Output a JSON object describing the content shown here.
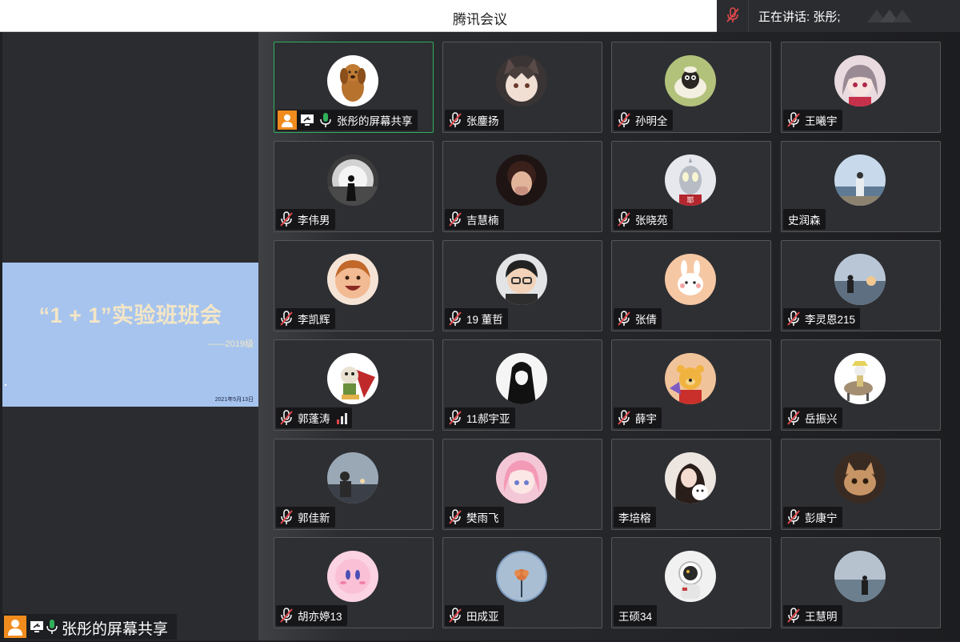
{
  "app": {
    "title": "腾讯会议"
  },
  "speaking": {
    "text": "正在讲话: 张彤;"
  },
  "slide": {
    "title": "“1 + 1”实验班班会",
    "subtitle": "——2019级",
    "date": "2021年5月13日"
  },
  "share": {
    "label": "张彤的屏幕共享"
  },
  "colors": {
    "accent_green": "#2fb05b",
    "host_orange": "#f08c1e",
    "muted_red": "#e0484b",
    "slide_bg": "#a6c4ee"
  },
  "participants": [
    {
      "name": "张彤的屏幕共享",
      "mic": "on",
      "host": true,
      "sharing": true,
      "active": true,
      "avatar": "dog-photo"
    },
    {
      "name": "张鏖扬",
      "mic": "muted",
      "avatar": "anime-catgirl"
    },
    {
      "name": "孙明全",
      "mic": "muted",
      "avatar": "sheep-cartoon"
    },
    {
      "name": "王曦宇",
      "mic": "muted",
      "avatar": "anime-girl"
    },
    {
      "name": "李伟男",
      "mic": "muted",
      "avatar": "silhouette-bw"
    },
    {
      "name": "吉慧楠",
      "mic": "muted",
      "avatar": "child-photo"
    },
    {
      "name": "张晓苑",
      "mic": "muted",
      "avatar": "ultraman"
    },
    {
      "name": "史润森",
      "mic": "none",
      "avatar": "seaside-person"
    },
    {
      "name": "李凯辉",
      "mic": "muted",
      "avatar": "laughing-baby"
    },
    {
      "name": "19 董哲",
      "mic": "muted",
      "avatar": "boy-glasses"
    },
    {
      "name": "张倩",
      "mic": "muted",
      "avatar": "bunny-sticker"
    },
    {
      "name": "李灵恩215",
      "mic": "muted",
      "avatar": "sunset-person"
    },
    {
      "name": "郭蓬涛",
      "mic": "muted",
      "signal": true,
      "avatar": "cartoon-cape"
    },
    {
      "name": "11郝宇亚",
      "mic": "muted",
      "avatar": "bw-sketch"
    },
    {
      "name": "薛宇",
      "mic": "muted",
      "avatar": "winnie-pooh"
    },
    {
      "name": "岳振兴",
      "mic": "muted",
      "avatar": "donkey-rider"
    },
    {
      "name": "郭佳新",
      "mic": "muted",
      "avatar": "evening-girl"
    },
    {
      "name": "樊雨飞",
      "mic": "muted",
      "avatar": "pink-anime"
    },
    {
      "name": "李培榕",
      "mic": "none",
      "avatar": "girl-with-dog"
    },
    {
      "name": "彭康宁",
      "mic": "muted",
      "avatar": "cat-photo"
    },
    {
      "name": "胡亦婷13",
      "mic": "muted",
      "avatar": "kirby"
    },
    {
      "name": "田成亚",
      "mic": "muted",
      "avatar": "flower-blue"
    },
    {
      "name": "王硕34",
      "mic": "none",
      "avatar": "astronaut-toy"
    },
    {
      "name": "王慧明",
      "mic": "muted",
      "avatar": "sea-person"
    }
  ]
}
